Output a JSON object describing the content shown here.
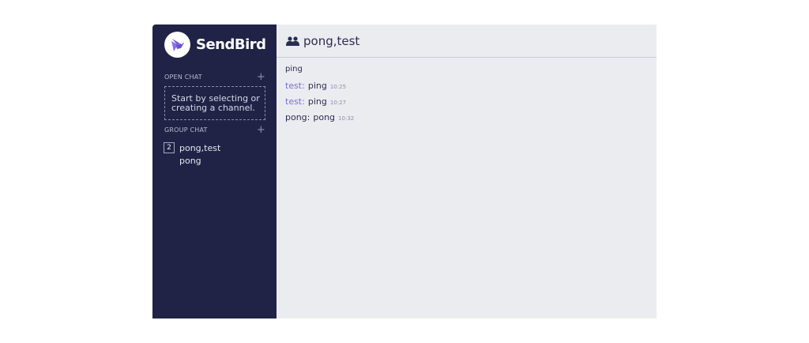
{
  "brand": {
    "name": "SendBird",
    "logo_icon": "sendbird-bird-icon"
  },
  "colors": {
    "sidebar": "#202346",
    "main_bg": "#ebecf0",
    "accent": "#7c6bd6",
    "logo_bg": "#ffffff"
  },
  "sidebar": {
    "open_chat": {
      "label": "OPEN CHAT",
      "add_icon": "plus-icon",
      "empty_text_line1": "Start by selecting or",
      "empty_text_line2": "creating a channel."
    },
    "group_chat": {
      "label": "GROUP CHAT",
      "add_icon": "plus-icon",
      "channels": [
        {
          "member_count": "2",
          "title": "pong,test",
          "last_message": "pong"
        }
      ]
    }
  },
  "main": {
    "header": {
      "icon": "people-icon",
      "title": "pong,test"
    },
    "messages": [
      {
        "type": "system",
        "text": "ping"
      },
      {
        "type": "user",
        "sender": "test:",
        "text": "ping",
        "time": "10:25",
        "role": "other"
      },
      {
        "type": "user",
        "sender": "test:",
        "text": "ping",
        "time": "10:27",
        "role": "other"
      },
      {
        "type": "user",
        "sender": "pong:",
        "text": "pong",
        "time": "10:32",
        "role": "self"
      }
    ]
  }
}
